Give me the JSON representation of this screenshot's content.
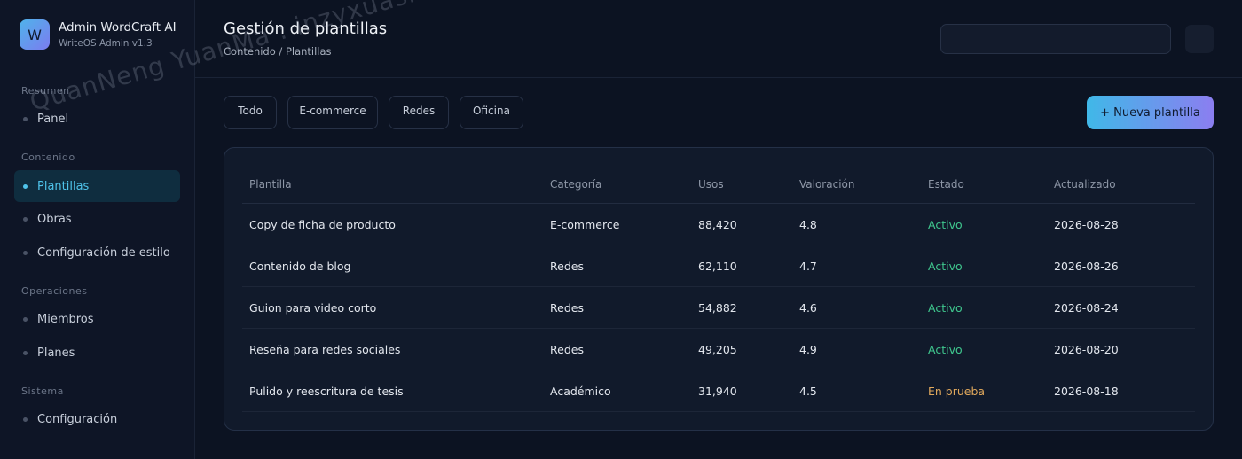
{
  "brand": {
    "logo_letter": "W",
    "name": "Admin WordCraft AI",
    "subtitle": "WriteOS Admin v1.3"
  },
  "sidebar": {
    "sections": [
      {
        "label": "Resumen",
        "items": [
          {
            "label": "Panel",
            "active": false
          }
        ]
      },
      {
        "label": "Contenido",
        "items": [
          {
            "label": "Plantillas",
            "active": true
          },
          {
            "label": "Obras",
            "active": false
          },
          {
            "label": "Configuración de estilo",
            "active": false
          }
        ]
      },
      {
        "label": "Operaciones",
        "items": [
          {
            "label": "Miembros",
            "active": false
          },
          {
            "label": "Planes",
            "active": false
          }
        ]
      },
      {
        "label": "Sistema",
        "items": [
          {
            "label": "Configuración",
            "active": false
          }
        ]
      }
    ]
  },
  "header": {
    "title": "Gestión de plantillas",
    "breadcrumb": "Contenido / Plantillas",
    "search_placeholder": ""
  },
  "filters": [
    "Todo",
    "E-commerce",
    "Redes",
    "Oficina"
  ],
  "new_button_label": "+ Nueva plantilla",
  "table": {
    "columns": [
      "Plantilla",
      "Categoría",
      "Usos",
      "Valoración",
      "Estado",
      "Actualizado"
    ],
    "rows": [
      [
        "Copy de ficha de producto",
        "E-commerce",
        "88,420",
        "4.8",
        "Activo",
        "2026-08-28"
      ],
      [
        "Contenido de blog",
        "Redes",
        "62,110",
        "4.7",
        "Activo",
        "2026-08-26"
      ],
      [
        "Guion para video corto",
        "Redes",
        "54,882",
        "4.6",
        "Activo",
        "2026-08-24"
      ],
      [
        "Reseña para redes sociales",
        "Redes",
        "49,205",
        "4.9",
        "Activo",
        "2026-08-20"
      ],
      [
        "Pulido y reescritura de tesis",
        "Académico",
        "31,940",
        "4.5",
        "En prueba",
        "2026-08-18"
      ]
    ]
  },
  "watermark": "QuanNeng YuanMa : inzyxuashop.com",
  "colors": {
    "accent": "#4fc3ea",
    "active_status": "#3fc78e",
    "test_status": "#e0a85c",
    "background": "#0c1322"
  }
}
